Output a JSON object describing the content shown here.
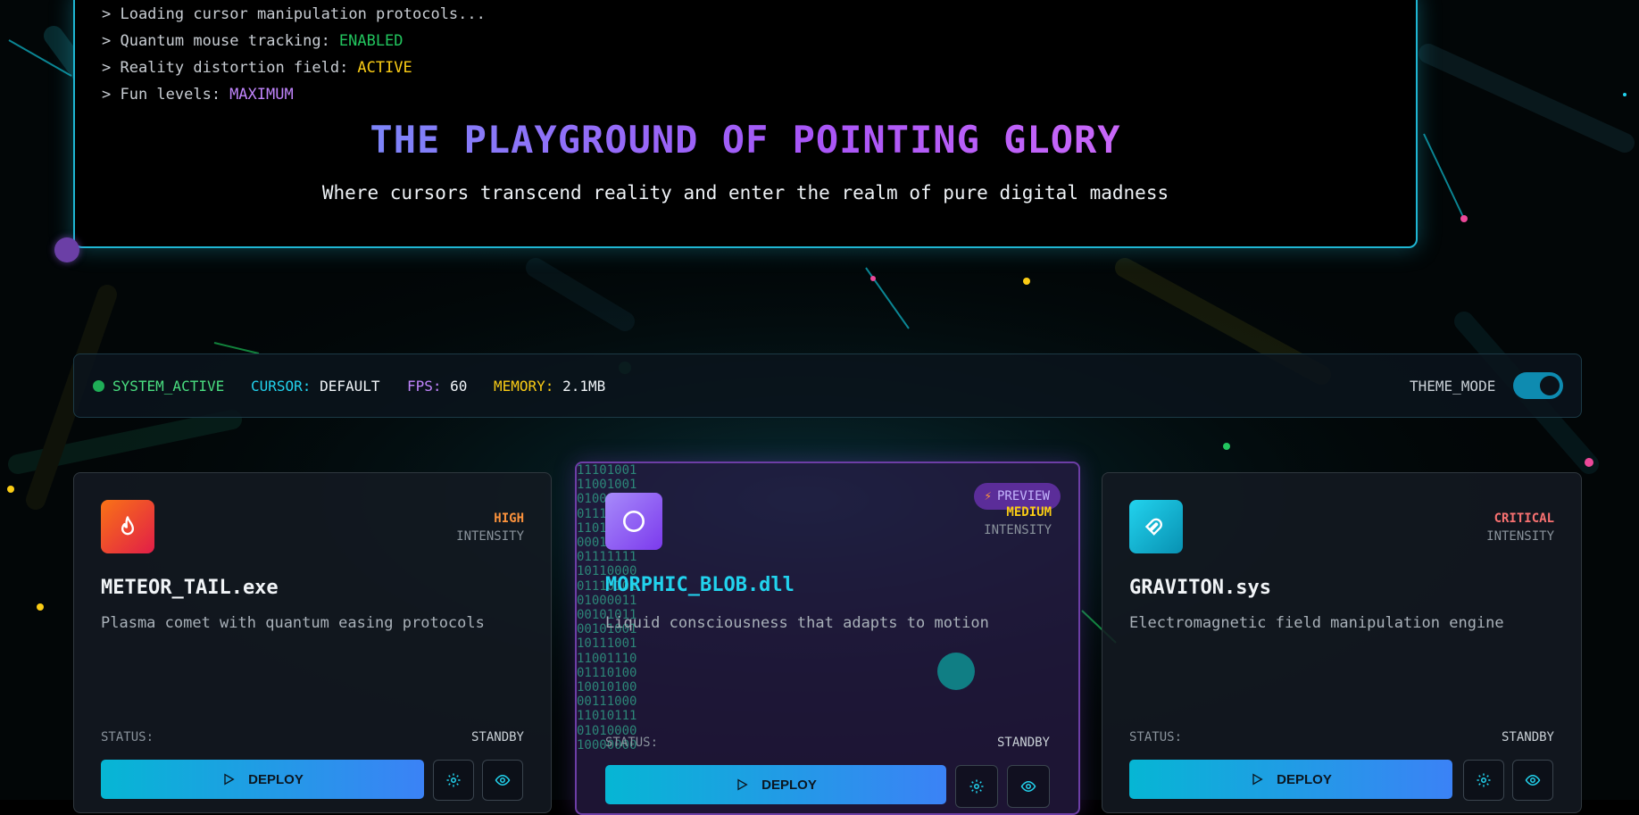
{
  "boot_lines": [
    {
      "label": "> Loading cursor manipulation protocols...",
      "value": "",
      "color": ""
    },
    {
      "label": "> Quantum mouse tracking:",
      "value": "ENABLED",
      "color": "#22c55e"
    },
    {
      "label": "> Reality distortion field:",
      "value": "ACTIVE",
      "color": "#facc15"
    },
    {
      "label": "> Fun levels:",
      "value": "MAXIMUM",
      "color": "#c084fc"
    }
  ],
  "hero": {
    "title": "THE PLAYGROUND OF POINTING GLORY",
    "subtitle": "Where cursors transcend reality and enter the realm of pure digital madness"
  },
  "status": {
    "system": "SYSTEM_ACTIVE",
    "cursor_label": "CURSOR:",
    "cursor_value": "DEFAULT",
    "fps_label": "FPS:",
    "fps_value": "60",
    "memory_label": "MEMORY:",
    "memory_value": "2.1MB",
    "theme_label": "THEME_MODE",
    "theme_on": true
  },
  "cards": [
    {
      "title": "METEOR_TAIL.exe",
      "intensity": "HIGH",
      "intensity_color": "#fb923c",
      "intensity_label": "INTENSITY",
      "desc": "Plasma comet with quantum easing protocols",
      "status_label": "STATUS:",
      "status_value": "STANDBY",
      "deploy": "DEPLOY",
      "icon": "flame-icon"
    },
    {
      "title": "MORPHIC_BLOB.dll",
      "intensity": "MEDIUM",
      "intensity_color": "#facc15",
      "intensity_label": "INTENSITY",
      "desc": "Liquid consciousness that adapts to motion",
      "status_label": "STATUS:",
      "status_value": "STANDBY",
      "deploy": "DEPLOY",
      "icon": "circle-icon",
      "badge": "PREVIEW",
      "binary": [
        "11101001",
        "11001001",
        "01001001",
        "01110101",
        "11010110",
        "00011110",
        "01111111",
        "10110000",
        "01110101",
        "01000011",
        "00101011",
        "00101001",
        "10111001",
        "11001110",
        "01110100",
        "10010100",
        "00111000",
        "11010111",
        "01010000",
        "10000000"
      ]
    },
    {
      "title": "GRAVITON.sys",
      "intensity": "CRITICAL",
      "intensity_color": "#f87171",
      "intensity_label": "INTENSITY",
      "desc": "Electromagnetic field manipulation engine",
      "status_label": "STATUS:",
      "status_value": "STANDBY",
      "deploy": "DEPLOY",
      "icon": "magnet-icon"
    }
  ]
}
